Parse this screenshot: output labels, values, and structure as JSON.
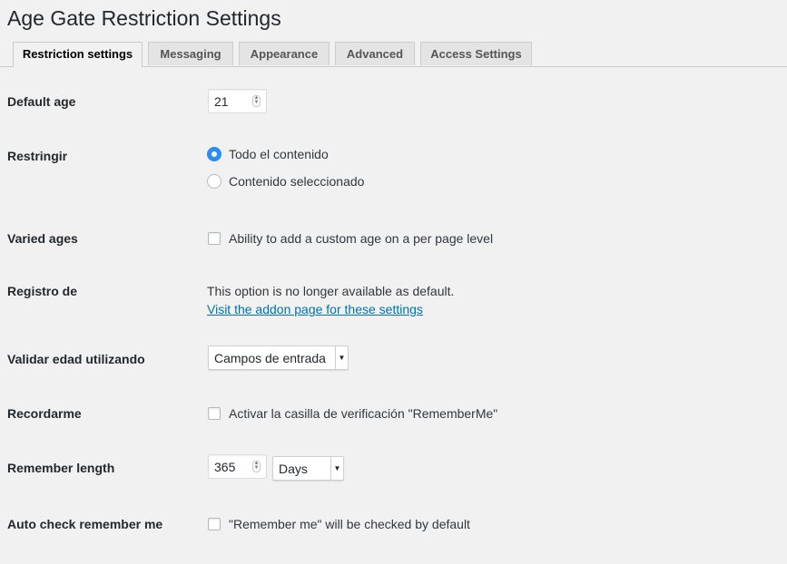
{
  "page": {
    "title": "Age Gate Restriction Settings"
  },
  "tabs": [
    {
      "label": "Restriction settings",
      "active": true
    },
    {
      "label": "Messaging",
      "active": false
    },
    {
      "label": "Appearance",
      "active": false
    },
    {
      "label": "Advanced",
      "active": false
    },
    {
      "label": "Access Settings",
      "active": false
    }
  ],
  "settings": {
    "default_age": {
      "label": "Default age",
      "value": "21"
    },
    "restrict": {
      "label": "Restringir",
      "options": [
        {
          "label": "Todo el contenido",
          "checked": true
        },
        {
          "label": "Contenido seleccionado",
          "checked": false
        }
      ]
    },
    "varied_ages": {
      "label": "Varied ages",
      "checkbox_label": "Ability to add a custom age on a per page level",
      "checked": false
    },
    "registro": {
      "label": "Registro de",
      "text": "This option is no longer available as default.",
      "link": "Visit the addon page for these settings"
    },
    "validate": {
      "label": "Validar edad utilizando",
      "selected": "Campos de entrada"
    },
    "remember": {
      "label": "Recordarme",
      "checkbox_label": "Activar la casilla de verificación \"RememberMe\"",
      "checked": false
    },
    "remember_length": {
      "label": "Remember length",
      "value": "365",
      "unit": "Days"
    },
    "auto_check": {
      "label": "Auto check remember me",
      "checkbox_label": "\"Remember me\" will be checked by default",
      "checked": false
    }
  },
  "colors": {
    "accent": "#2b8cf7",
    "link": "#0073aa",
    "background": "#f1f1f1"
  }
}
